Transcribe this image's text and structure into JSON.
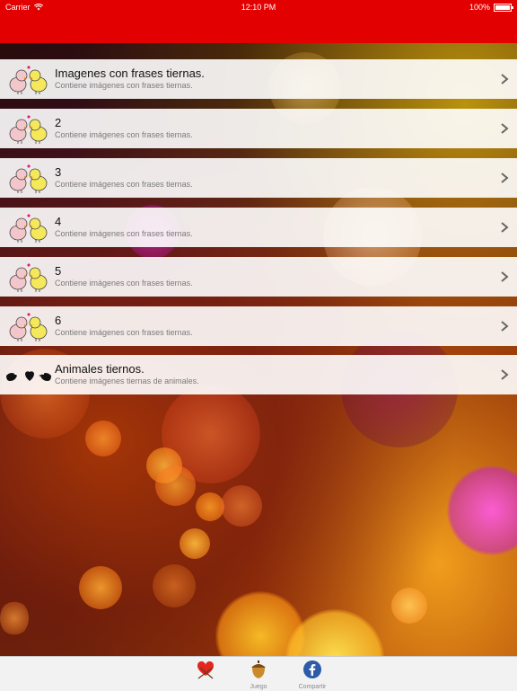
{
  "status_bar": {
    "carrier": "Carrier",
    "time": "12:10 PM",
    "battery": "100%"
  },
  "list": {
    "items": [
      {
        "title": "Imagenes con frases tiernas.",
        "subtitle": "Contiene imágenes con frases tiernas.",
        "icon": "lovebirds-icon"
      },
      {
        "title": "2",
        "subtitle": "Contiene imágenes con frases tiernas.",
        "icon": "lovebirds-icon"
      },
      {
        "title": "3",
        "subtitle": "Contiene imágenes con frases tiernas.",
        "icon": "lovebirds-icon"
      },
      {
        "title": "4",
        "subtitle": "Contiene imágenes con frases tiernas.",
        "icon": "lovebirds-icon"
      },
      {
        "title": "5",
        "subtitle": "Contiene imágenes con frases tiernas.",
        "icon": "lovebirds-icon"
      },
      {
        "title": "6",
        "subtitle": "Contiene imágenes con frases tiernas.",
        "icon": "lovebirds-icon"
      },
      {
        "title": "Animales tiernos.",
        "subtitle": "Contiene imágenes tiernas de animales.",
        "icon": "birds-heart-icon"
      }
    ]
  },
  "tab_bar": {
    "tabs": [
      {
        "label": "",
        "icon": "heart-icon",
        "selected": true
      },
      {
        "label": "Juego",
        "icon": "acorn-icon",
        "selected": false
      },
      {
        "label": "Compartir",
        "icon": "facebook-icon",
        "selected": false
      }
    ]
  },
  "colors": {
    "nav_bar": "#e30000",
    "cell_background": "#ffffff",
    "tab_bar": "#f2f2f2"
  }
}
